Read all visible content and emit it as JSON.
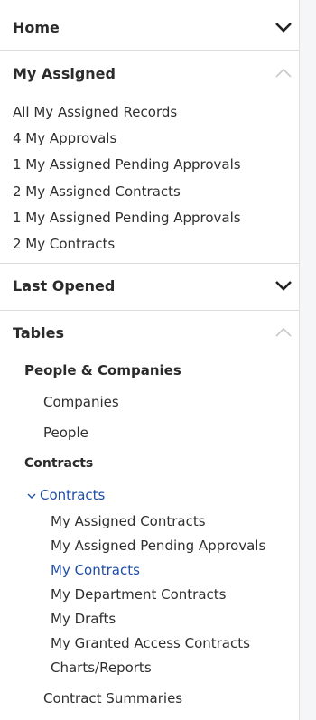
{
  "sections": {
    "home": {
      "title": "Home",
      "icon": "chevron-down-icon"
    },
    "my_assigned": {
      "title": "My Assigned",
      "icon": "chevron-up-icon",
      "items": [
        "All My Assigned Records",
        "4 My Approvals",
        "1 My Assigned Pending Approvals",
        "2 My Assigned Contracts",
        "1 My Assigned Pending Approvals",
        "2 My Contracts"
      ]
    },
    "last_opened": {
      "title": "Last Opened",
      "icon": "chevron-down-icon"
    },
    "tables": {
      "title": "Tables",
      "icon": "chevron-up-icon",
      "groups": {
        "people_companies": {
          "title": "People & Companies",
          "items": [
            "Companies",
            "People"
          ]
        },
        "contracts": {
          "title": "Contracts",
          "expanded_label": "Contracts",
          "expanded_icon": "chevron-down-small-icon",
          "items": [
            "My Assigned Contracts",
            "My Assigned Pending Approvals",
            "My Contracts",
            "My Department Contracts",
            "My Drafts",
            "My Granted Access Contracts",
            "Charts/Reports"
          ],
          "active_item": "My Contracts",
          "summary": "Contract Summaries"
        }
      }
    }
  },
  "colors": {
    "active_link": "#1f4ea8",
    "divider": "#dcdcdc",
    "chevron_dark": "#222222",
    "chevron_light": "#c8c8c8"
  }
}
